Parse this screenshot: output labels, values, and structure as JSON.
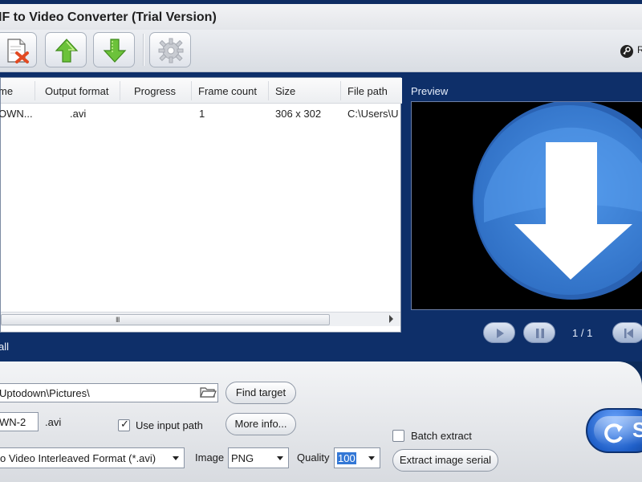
{
  "window": {
    "title": "IF to Video Converter (Trial Version)"
  },
  "toolbar": {
    "buttons": [
      {
        "icon": "remove-file-icon"
      },
      {
        "icon": "move-up-icon"
      },
      {
        "icon": "move-down-icon"
      },
      {
        "icon": "settings-gear-icon"
      }
    ],
    "help_partial": "R"
  },
  "file_list": {
    "columns": [
      "me",
      "Output format",
      "Progress",
      "Frame count",
      "Size",
      "File path"
    ],
    "rows": [
      {
        "name": "OWN...",
        "output_format": ".avi",
        "progress": "",
        "frame_count": "1",
        "size": "306 x 302",
        "file_path": "C:\\Users\\U"
      }
    ],
    "scroll_grip": "III"
  },
  "preview": {
    "label": "Preview",
    "frame_counter": "1 / 1"
  },
  "status": {
    "all_label": "all"
  },
  "output": {
    "path_value": "Uptodown\\Pictures\\",
    "find_target_label": "Find target",
    "filename_value": "WN-2",
    "extension": ".avi",
    "use_input_path_label": "Use input path",
    "use_input_path_checked": true,
    "more_info_label": "More info...",
    "format_value": "o Video Interleaved Format (*.avi)",
    "image_label": "Image",
    "image_value": "PNG",
    "quality_label": "Quality",
    "quality_value": "100",
    "batch_extract_label": "Batch extract",
    "batch_extract_checked": false,
    "extract_serial_label": "Extract image serial",
    "start_partial": "S"
  },
  "colors": {
    "main_blue": "#0e2f69",
    "preview_circle": "#3f86dd",
    "accent": "#3478d6"
  }
}
